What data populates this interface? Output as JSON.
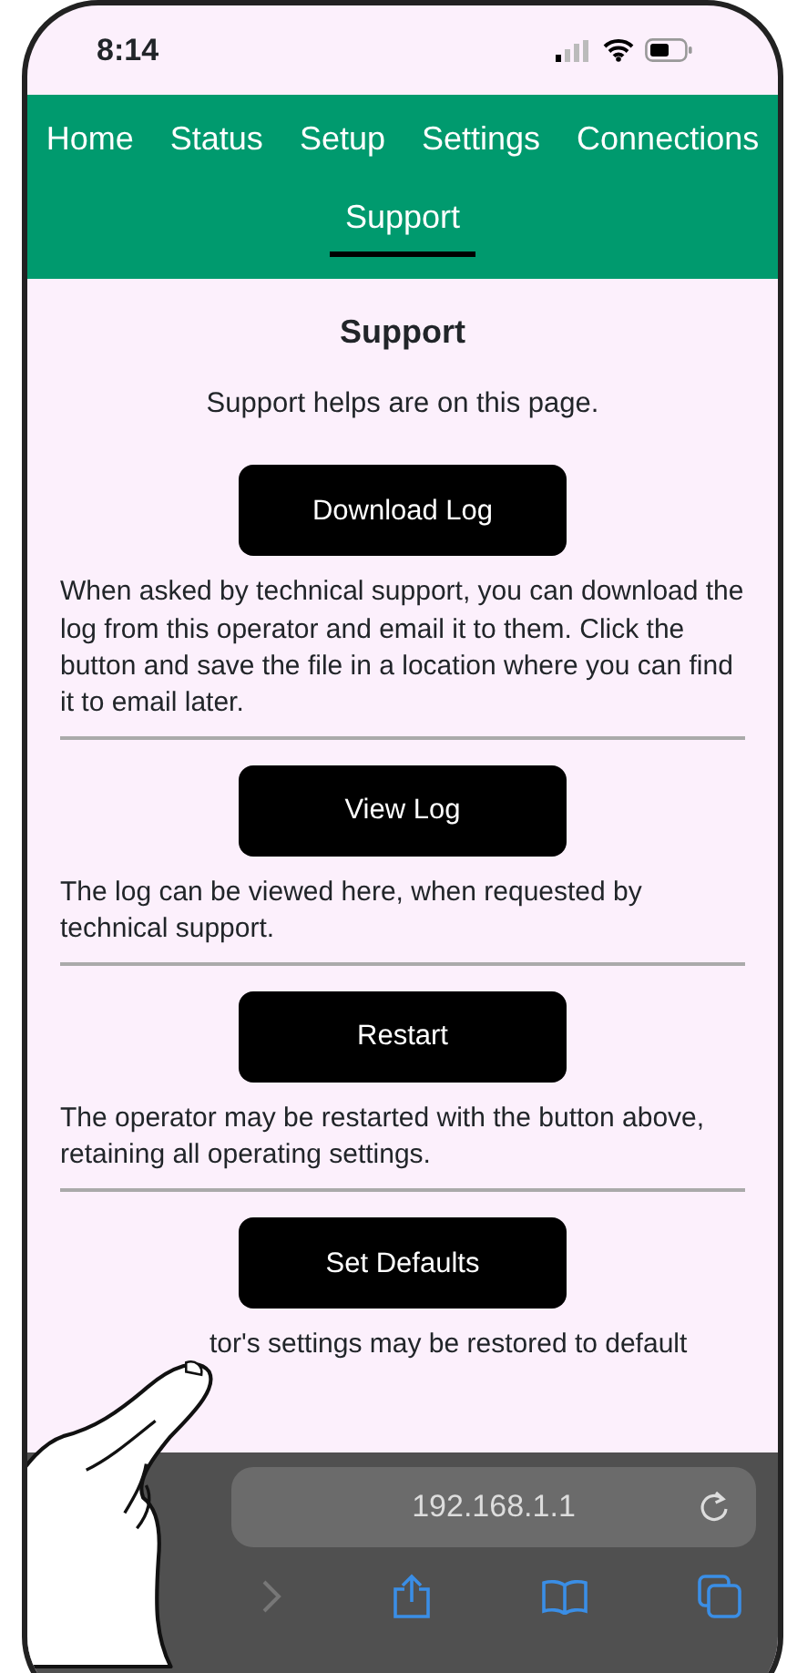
{
  "status_bar": {
    "time": "8:14"
  },
  "nav": {
    "tabs": [
      {
        "label": "Home",
        "selected": false
      },
      {
        "label": "Status",
        "selected": false
      },
      {
        "label": "Setup",
        "selected": false
      },
      {
        "label": "Settings",
        "selected": false
      },
      {
        "label": "Connections",
        "selected": false
      },
      {
        "label": "Support",
        "selected": true
      }
    ]
  },
  "page": {
    "title": "Support",
    "intro": "Support helps are on this page.",
    "sections": [
      {
        "button": "Download Log",
        "text": "When asked by technical support, you can download the log from this operator and email it to them. Click the button and save the file in a location where you can find it to email later."
      },
      {
        "button": "View Log",
        "text": "The log can be viewed here, when requested by technical support."
      },
      {
        "button": "Restart",
        "text": "The operator may be restarted with the button above, retaining all operating settings."
      },
      {
        "button": "Set Defaults",
        "text": "tor's settings may be restored to default"
      }
    ]
  },
  "browser": {
    "url": "192.168.1.1"
  }
}
